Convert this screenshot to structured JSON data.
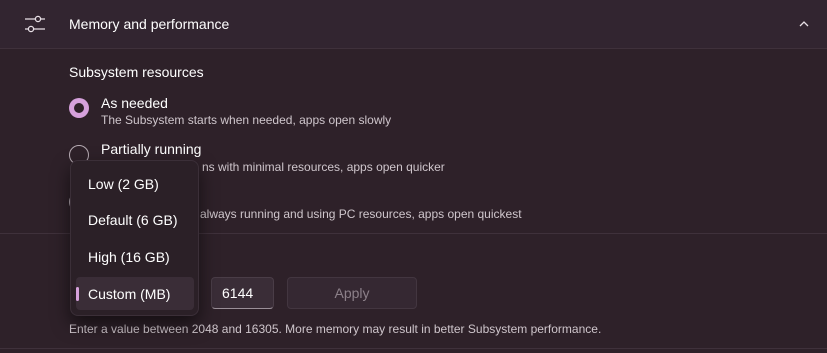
{
  "header": {
    "title": "Memory and performance",
    "icon": "sliders-icon",
    "collapse_icon": "chevron-up-icon"
  },
  "resources": {
    "label": "Subsystem resources",
    "options": [
      {
        "title": "As needed",
        "description": "The Subsystem starts when needed, apps open slowly",
        "checked": true
      },
      {
        "title": "Partially running",
        "description": "ns with minimal resources, apps open quicker",
        "checked": false
      },
      {
        "title": "",
        "description": "always running and using PC resources, apps open quickest",
        "checked": false
      }
    ]
  },
  "memory": {
    "dropdown_options": [
      "Low (2 GB)",
      "Default (6 GB)",
      "High (16 GB)",
      "Custom (MB)"
    ],
    "selected_option": "Custom (MB)",
    "value": "6144",
    "apply_label": "Apply",
    "hint": "Enter a value between 2048 and 16305. More memory may result in better Subsystem performance."
  },
  "colors": {
    "accent": "#d6a1dc",
    "background": "#2e2129",
    "header_background": "#322530"
  }
}
